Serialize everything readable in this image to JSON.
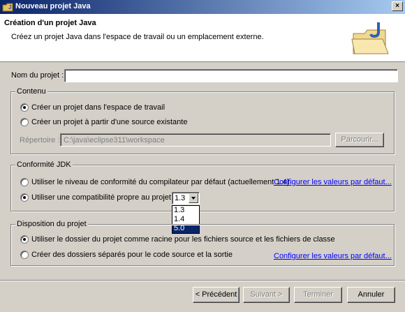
{
  "window": {
    "title": "Nouveau projet Java",
    "close_label": "×"
  },
  "banner": {
    "title": "Création d'un projet Java",
    "description": "Créez un projet Java dans l'espace de travail ou un emplacement externe."
  },
  "project_name": {
    "label": "Nom du projet :",
    "value": ""
  },
  "content_group": {
    "title": "Contenu",
    "option_workspace": "Créer un projet dans l'espace de travail",
    "option_external": "Créer un projet à partir d'une source existante",
    "directory_label": "Répertoire :",
    "directory_value": "C:\\java\\eclipse311\\workspace",
    "browse_label": "Parcourir..."
  },
  "jdk_group": {
    "title": "Conformité JDK",
    "option_default": "Utiliser le niveau de conformité du compilateur par défaut (actuellement 1.4)",
    "option_specific": "Utiliser une compatibilité propre au projet :",
    "configure_link": "Configurer les valeurs par défaut...",
    "selected_value": "1.3",
    "dropdown_options": [
      "1.3",
      "1.4",
      "5.0"
    ],
    "highlighted_option": "5.0"
  },
  "layout_group": {
    "title": "Disposition du projet",
    "option_root": "Utiliser le dossier du projet comme racine pour les fichiers source et les fichiers de classe",
    "option_separate": "Créer des dossiers séparés pour le code source et la sortie",
    "configure_link": "Configurer les valeurs par défaut..."
  },
  "buttons": {
    "back": "< Précédent",
    "next": "Suivant >",
    "finish": "Terminer",
    "cancel": "Annuler"
  },
  "colors": {
    "title_start": "#0a246a",
    "title_end": "#a6caf0",
    "link": "#0000ff",
    "selection": "#0a246a"
  }
}
